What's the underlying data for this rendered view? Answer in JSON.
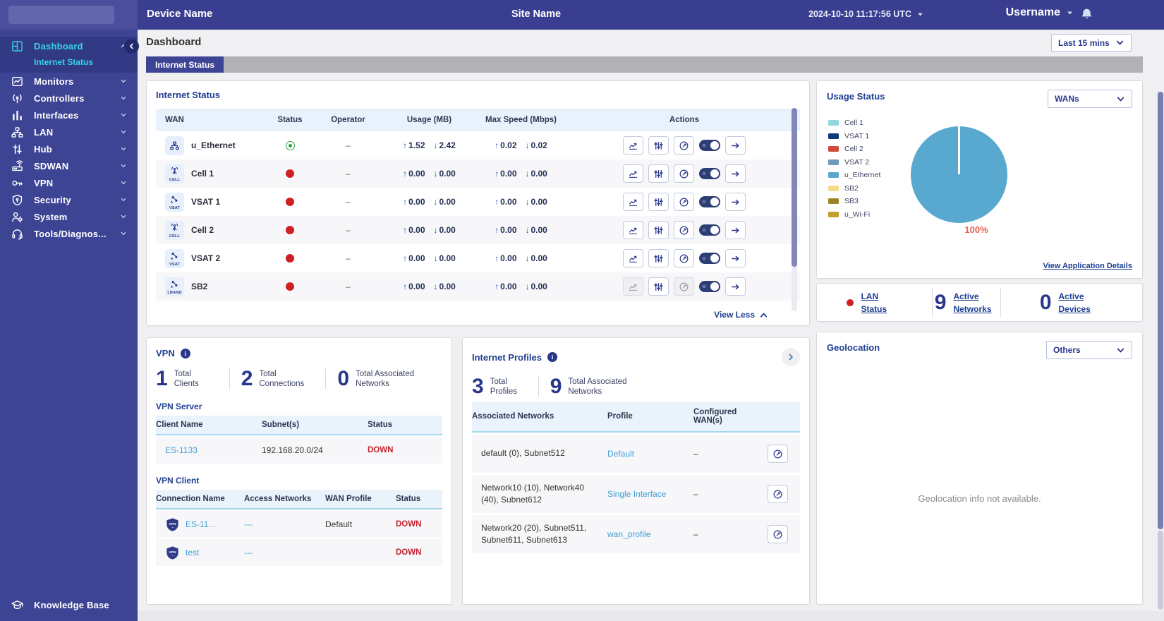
{
  "topbar": {
    "device_name": "Device Name",
    "site_name": "Site Name",
    "timestamp": "2024-10-10 11:17:56 UTC",
    "username": "Username"
  },
  "sidebar": {
    "items": [
      {
        "label": "Dashboard",
        "icon": "dashboard",
        "active": true,
        "expanded": true
      },
      {
        "label": "Internet Status",
        "sub": true
      },
      {
        "label": "Monitors",
        "icon": "monitors"
      },
      {
        "label": "Controllers",
        "icon": "controllers"
      },
      {
        "label": "Interfaces",
        "icon": "interfaces"
      },
      {
        "label": "LAN",
        "icon": "lan"
      },
      {
        "label": "Hub",
        "icon": "hub"
      },
      {
        "label": "SDWAN",
        "icon": "sdwan"
      },
      {
        "label": "VPN",
        "icon": "vpn"
      },
      {
        "label": "Security",
        "icon": "security"
      },
      {
        "label": "System",
        "icon": "system"
      },
      {
        "label": "Tools/Diagnos...",
        "icon": "tools"
      }
    ],
    "footer": {
      "label": "Knowledge Base",
      "icon": "knowledge"
    }
  },
  "page": {
    "title": "Dashboard",
    "time_filter": "Last 15 mins",
    "tab": "Internet Status"
  },
  "internet_status": {
    "title": "Internet Status",
    "columns": [
      "WAN",
      "Status",
      "Operator",
      "Usage (MB)",
      "Max Speed (Mbps)",
      "Actions"
    ],
    "rows": [
      {
        "name": "u_Ethernet",
        "icon": "ethernet",
        "tag": "",
        "status": "up",
        "operator": "–",
        "usage_up": "1.52",
        "usage_down": "2.42",
        "speed_up": "0.02",
        "speed_down": "0.02",
        "disabled": []
      },
      {
        "name": "Cell 1",
        "icon": "cell",
        "tag": "CELL",
        "status": "down",
        "operator": "–",
        "usage_up": "0.00",
        "usage_down": "0.00",
        "speed_up": "0.00",
        "speed_down": "0.00",
        "disabled": []
      },
      {
        "name": "VSAT 1",
        "icon": "vsat",
        "tag": "VSAT",
        "status": "down",
        "operator": "–",
        "usage_up": "0.00",
        "usage_down": "0.00",
        "speed_up": "0.00",
        "speed_down": "0.00",
        "disabled": []
      },
      {
        "name": "Cell 2",
        "icon": "cell",
        "tag": "CELL",
        "status": "down",
        "operator": "–",
        "usage_up": "0.00",
        "usage_down": "0.00",
        "speed_up": "0.00",
        "speed_down": "0.00",
        "disabled": []
      },
      {
        "name": "VSAT 2",
        "icon": "vsat",
        "tag": "VSAT",
        "status": "down",
        "operator": "–",
        "usage_up": "0.00",
        "usage_down": "0.00",
        "speed_up": "0.00",
        "speed_down": "0.00",
        "disabled": []
      },
      {
        "name": "SB2",
        "icon": "lband",
        "tag": "LBAND",
        "status": "down",
        "operator": "–",
        "usage_up": "0.00",
        "usage_down": "0.00",
        "speed_up": "0.00",
        "speed_down": "0.00",
        "disabled": [
          "chart",
          "gauge"
        ]
      }
    ],
    "view_less": "View Less"
  },
  "usage_status": {
    "title": "Usage Status",
    "filter": "WANs",
    "legend": [
      {
        "label": "Cell 1",
        "color": "#8fd8dc"
      },
      {
        "label": "VSAT 1",
        "color": "#0d3a78"
      },
      {
        "label": "Cell 2",
        "color": "#cf4a38"
      },
      {
        "label": "VSAT 2",
        "color": "#6d9cba"
      },
      {
        "label": "u_Ethernet",
        "color": "#58a8d0"
      },
      {
        "label": "SB2",
        "color": "#f2dd8e"
      },
      {
        "label": "SB3",
        "color": "#9c8428"
      },
      {
        "label": "u_Wi-Fi",
        "color": "#c2a02c"
      }
    ],
    "pie_color": "#58a8d0",
    "pie_label": "100%",
    "pie_label_color": "#e8604c",
    "link": "View Application Details"
  },
  "lan_overview": {
    "status_label": "LAN Status",
    "stats": [
      {
        "value": "9",
        "label": "Active Networks"
      },
      {
        "value": "0",
        "label": "Active Devices"
      }
    ]
  },
  "vpn": {
    "title": "VPN",
    "stats": [
      {
        "value": "1",
        "label": "Total Clients"
      },
      {
        "value": "2",
        "label": "Total Connections"
      },
      {
        "value": "0",
        "label": "Total Associated Networks"
      }
    ],
    "server": {
      "title": "VPN Server",
      "columns": [
        "Client Name",
        "Subnet(s)",
        "Status"
      ],
      "rows": [
        {
          "name": "ES-1133",
          "subnet": "192.168.20.0/24",
          "status": "DOWN"
        }
      ]
    },
    "client": {
      "title": "VPN Client",
      "columns": [
        "Connection Name",
        "Access Networks",
        "WAN Profile",
        "Status"
      ],
      "rows": [
        {
          "name": "ES-11...",
          "access": "---",
          "profile": "Default",
          "status": "DOWN"
        },
        {
          "name": "test",
          "access": "---",
          "profile": "",
          "status": "DOWN"
        }
      ]
    }
  },
  "internet_profiles": {
    "title": "Internet Profiles",
    "stats": [
      {
        "value": "3",
        "label": "Total Profiles"
      },
      {
        "value": "9",
        "label": "Total Associated Networks"
      }
    ],
    "columns": [
      "Associated Networks",
      "Profile",
      "Configured WAN(s)"
    ],
    "rows": [
      {
        "networks": "default (0), Subnet512",
        "profile": "Default",
        "wans": "–"
      },
      {
        "networks": "Network10 (10), Network40 (40), Subnet612",
        "profile": "Single Interface",
        "wans": "–"
      },
      {
        "networks": "Network20 (20), Subnet511, Subnet611, Subnet613",
        "profile": "wan_profile",
        "wans": "–"
      }
    ]
  },
  "geolocation": {
    "title": "Geolocation",
    "filter": "Others",
    "empty_text": "Geolocation info not available."
  },
  "chart_data": {
    "type": "pie",
    "title": "Usage Status",
    "labels": [
      "Cell 1",
      "VSAT 1",
      "Cell 2",
      "VSAT 2",
      "u_Ethernet",
      "SB2",
      "SB3",
      "u_Wi-Fi"
    ],
    "values": [
      0,
      0,
      0,
      0,
      100,
      0,
      0,
      0
    ],
    "unit": "%",
    "annotation": "100%",
    "colors": [
      "#8fd8dc",
      "#0d3a78",
      "#cf4a38",
      "#6d9cba",
      "#58a8d0",
      "#f2dd8e",
      "#9c8428",
      "#c2a02c"
    ],
    "legend_position": "left"
  }
}
